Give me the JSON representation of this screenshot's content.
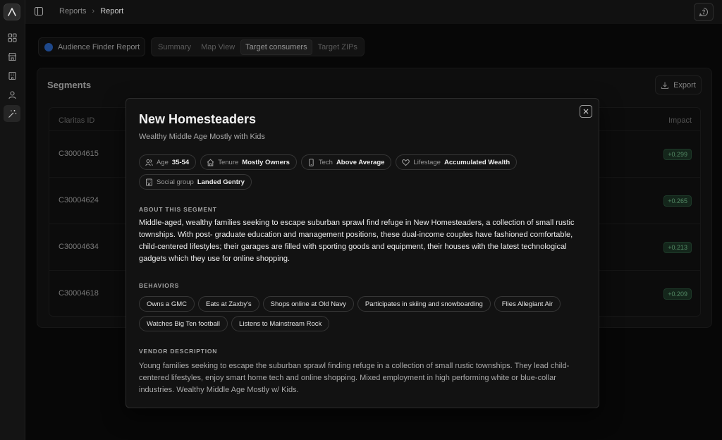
{
  "colors": {
    "accent_blue": "#2f6fd6",
    "impact_green": "#7fd29a",
    "impact_bg": "#1f3b2a"
  },
  "rail": {
    "items": [
      {
        "icon": "dashboard-grid-icon"
      },
      {
        "icon": "store-icon"
      },
      {
        "icon": "building-icon"
      },
      {
        "icon": "user-icon"
      },
      {
        "icon": "magic-wand-icon",
        "active": true
      }
    ]
  },
  "breadcrumb": {
    "root": "Reports",
    "current": "Report"
  },
  "report": {
    "name": "Audience Finder Report"
  },
  "tabs": [
    {
      "label": "Summary"
    },
    {
      "label": "Map View"
    },
    {
      "label": "Target consumers",
      "active": true
    },
    {
      "label": "Target ZIPs"
    }
  ],
  "segments": {
    "title": "Segments",
    "export_label": "Export",
    "columns": {
      "id": "Claritas ID",
      "impact": "Impact"
    },
    "rows": [
      {
        "id": "C30004615",
        "impact": "+0.299"
      },
      {
        "id": "C30004624",
        "impact": "+0.265"
      },
      {
        "id": "C30004634",
        "impact": "+0.213"
      },
      {
        "id": "C30004618",
        "impact": "+0.209"
      }
    ]
  },
  "modal": {
    "title": "New Homesteaders",
    "subtitle": "Wealthy Middle Age Mostly with Kids",
    "attributes": [
      {
        "icon": "people-icon",
        "label": "Age",
        "value": "35-54"
      },
      {
        "icon": "home-icon",
        "label": "Tenure",
        "value": "Mostly Owners"
      },
      {
        "icon": "phone-icon",
        "label": "Tech",
        "value": "Above Average"
      },
      {
        "icon": "heart-icon",
        "label": "Lifestage",
        "value": "Accumulated Wealth"
      },
      {
        "icon": "building-icon",
        "label": "Social group",
        "value": "Landed Gentry"
      }
    ],
    "about_heading": "ABOUT THIS SEGMENT",
    "about_text": "Middle-aged, wealthy families seeking to escape suburban sprawl find refuge in New Homesteaders, a collection of small rustic townships. With post- graduate education and management positions, these dual-income couples have fashioned comfortable, child-centered lifestyles; their garages are filled with sporting goods and equipment, their houses with the latest technological gadgets which they use for online shopping.",
    "behaviors_heading": "BEHAVIORS",
    "behaviors": [
      "Owns a GMC",
      "Eats at Zaxby's",
      "Shops online at Old Navy",
      "Participates in skiing and snowboarding",
      "Flies Allegiant Air",
      "Watches Big Ten football",
      "Listens to Mainstream Rock"
    ],
    "vendor_heading": "VENDOR DESCRIPTION",
    "vendor_text": "Young families seeking to escape the suburban sprawl finding refuge in a collection of small rustic townships. They lead child-centered lifestyles, enjoy smart home tech and online shopping. Mixed employment in high performing white or blue-collar industries. Wealthy Middle Age Mostly w/ Kids."
  }
}
